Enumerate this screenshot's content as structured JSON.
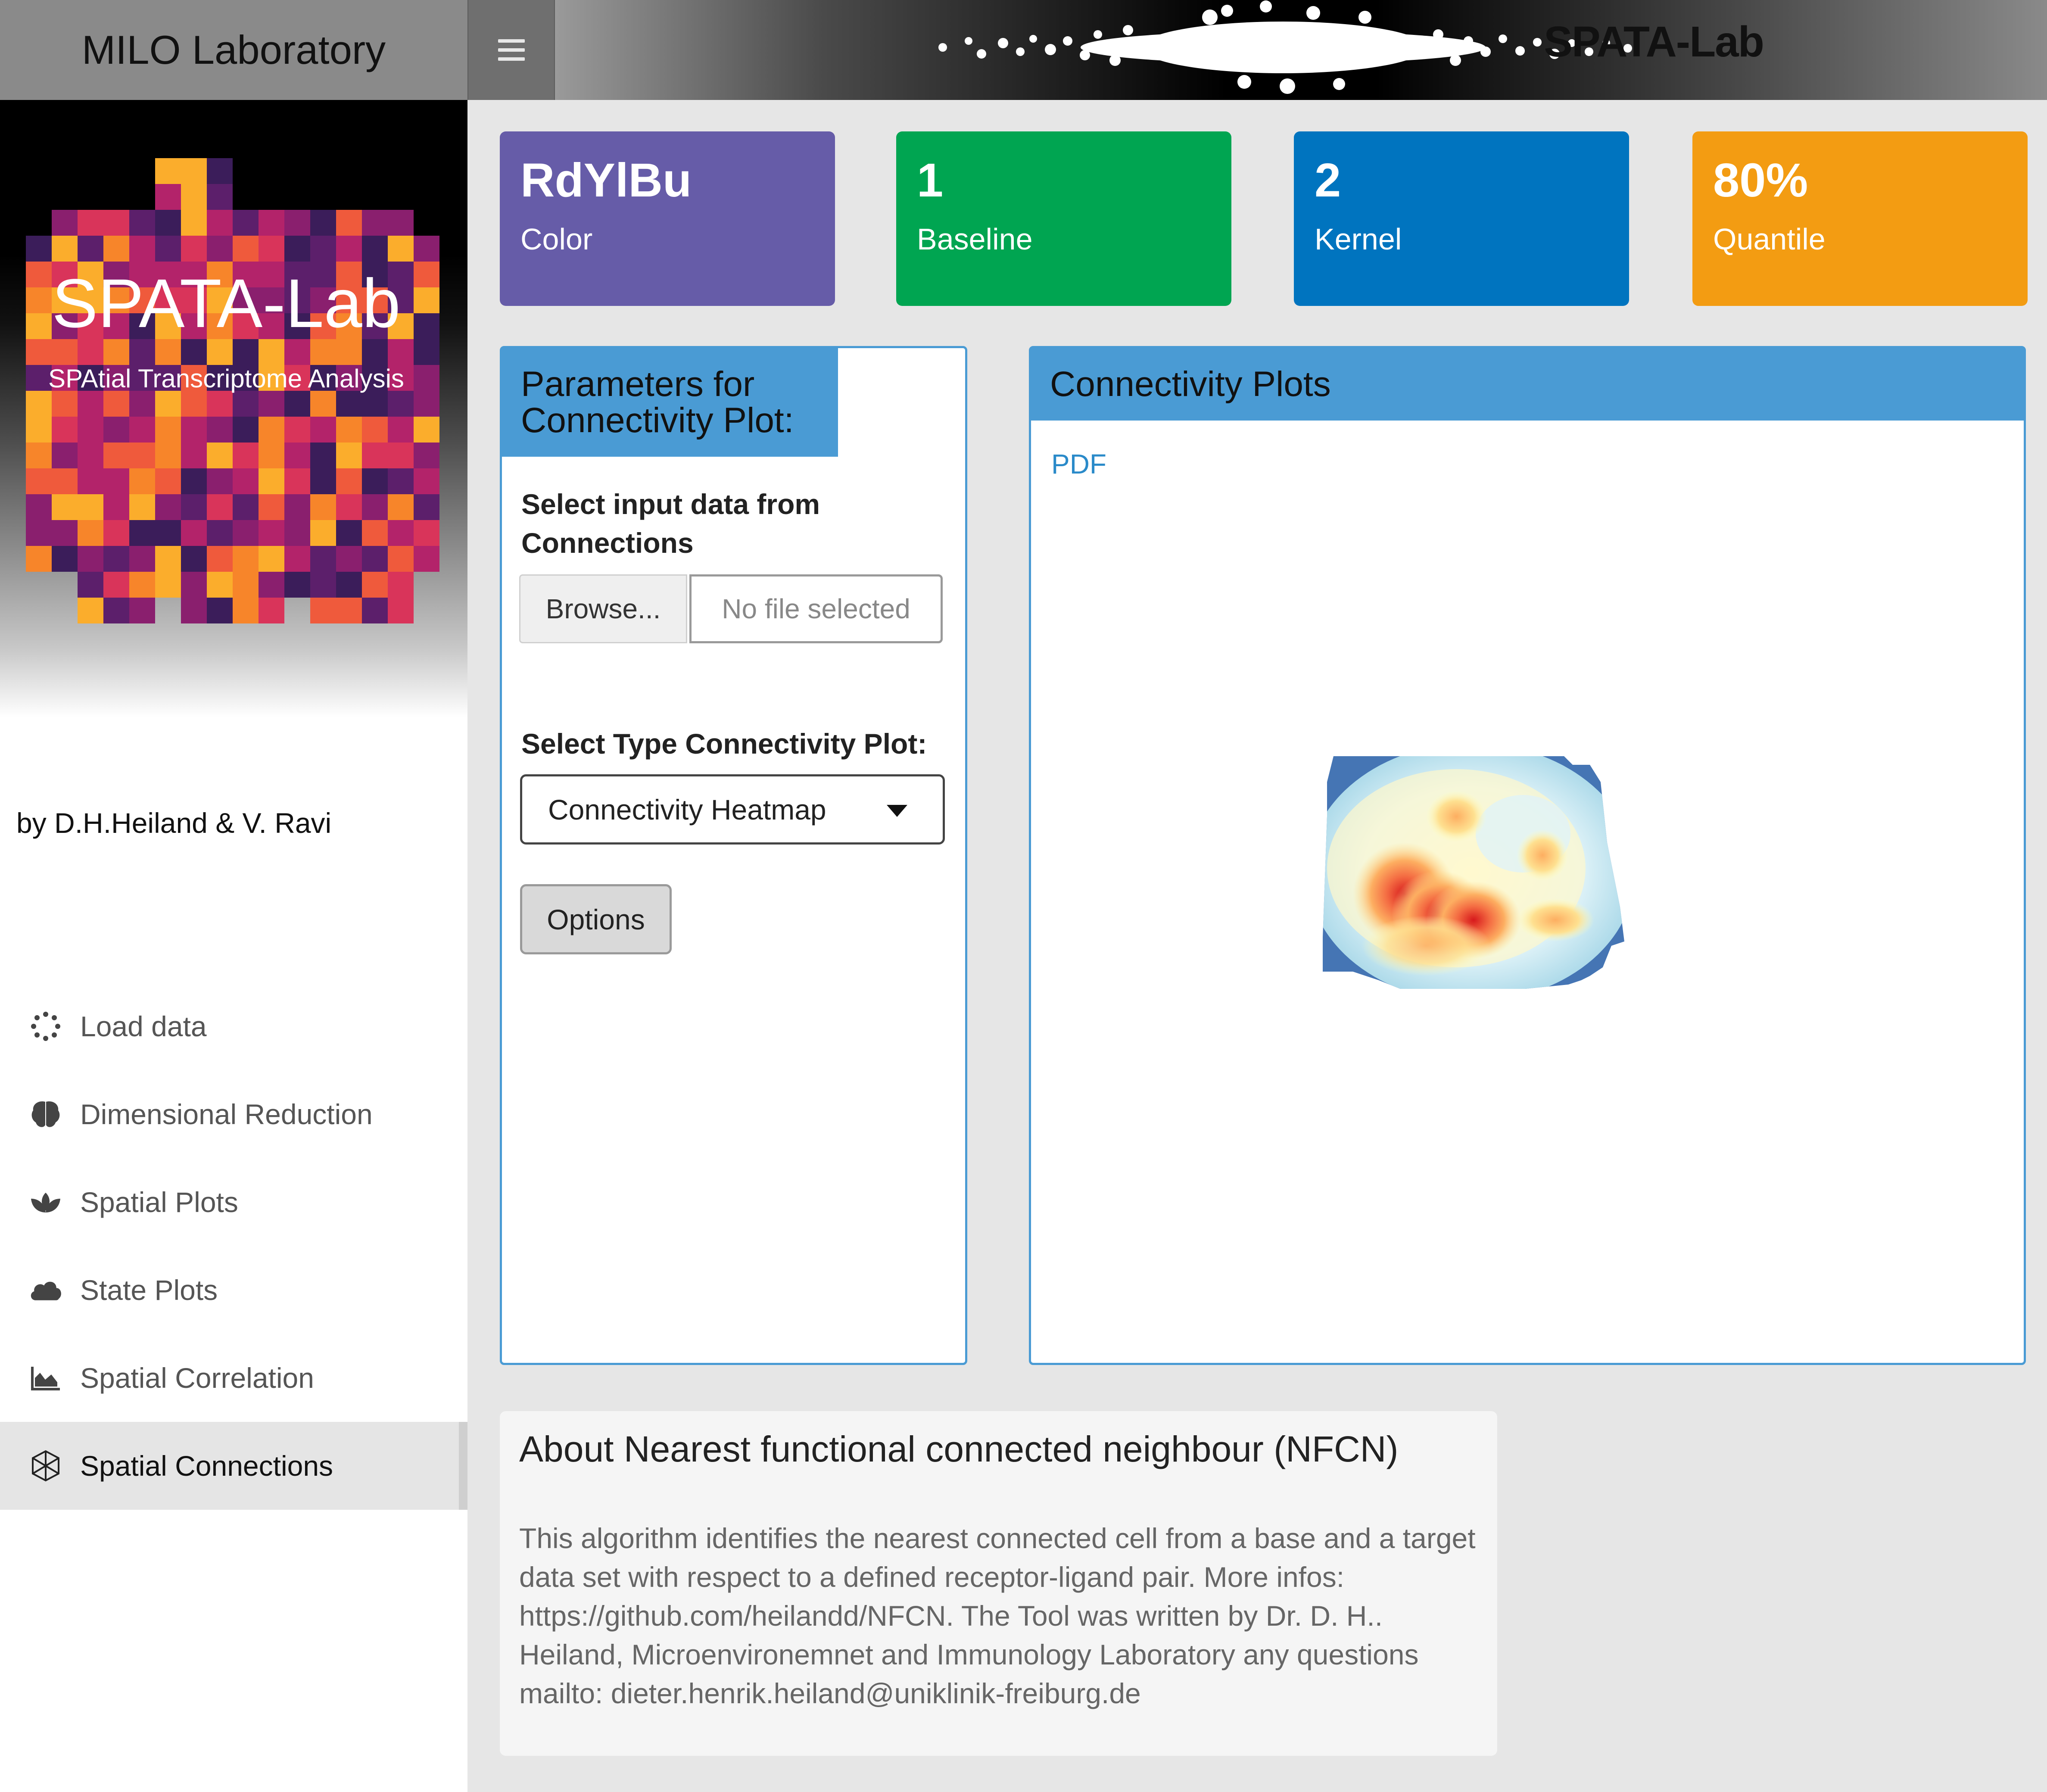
{
  "header": {
    "brand": "MILO Laboratory",
    "logo_text": "SPATA-Lab"
  },
  "sidebar": {
    "hero_title": "SPATA-Lab",
    "hero_subtitle": "SPAtial Transcriptome Analysis",
    "authors": "by D.H.Heiland & V. Ravi",
    "items": [
      {
        "label": "Load data",
        "icon": "spinner-icon"
      },
      {
        "label": "Dimensional Reduction",
        "icon": "brain-icon"
      },
      {
        "label": "Spatial Plots",
        "icon": "spa-icon"
      },
      {
        "label": "State Plots",
        "icon": "cloud-icon"
      },
      {
        "label": "Spatial Correlation",
        "icon": "area-chart-icon"
      },
      {
        "label": "Spatial Connections",
        "icon": "network-icon",
        "active": true
      }
    ]
  },
  "value_boxes": [
    {
      "value": "RdYlBu",
      "label": "Color",
      "color": "#665ca8"
    },
    {
      "value": "1",
      "label": "Baseline",
      "color": "#00a551"
    },
    {
      "value": "2",
      "label": "Kernel",
      "color": "#0074bf"
    },
    {
      "value": "80%",
      "label": "Quantile",
      "color": "#f39c12"
    }
  ],
  "params_panel": {
    "title": "Parameters for Connectivity Plot:",
    "input_label": "Select input data from Connections",
    "browse_label": "Browse...",
    "file_placeholder": "No file selected",
    "type_label": "Select Type Connectivity Plot:",
    "type_selected": "Connectivity Heatmap",
    "options_label": "Options"
  },
  "plots_panel": {
    "title": "Connectivity Plots",
    "pdf_link": "PDF"
  },
  "about": {
    "title": "About Nearest functional connected neighbour (NFCN)",
    "text": "This algorithm identifies the nearest connected cell from a base and a target data set with respect to a defined receptor-ligand pair. More infos: https://github.com/heilandd/NFCN. The Tool was written by Dr. D. H.. Heiland, Microenvironemnet and Immunology Laboratory any questions mailto: dieter.henrik.heiland@uniklinik-freiburg.de"
  }
}
